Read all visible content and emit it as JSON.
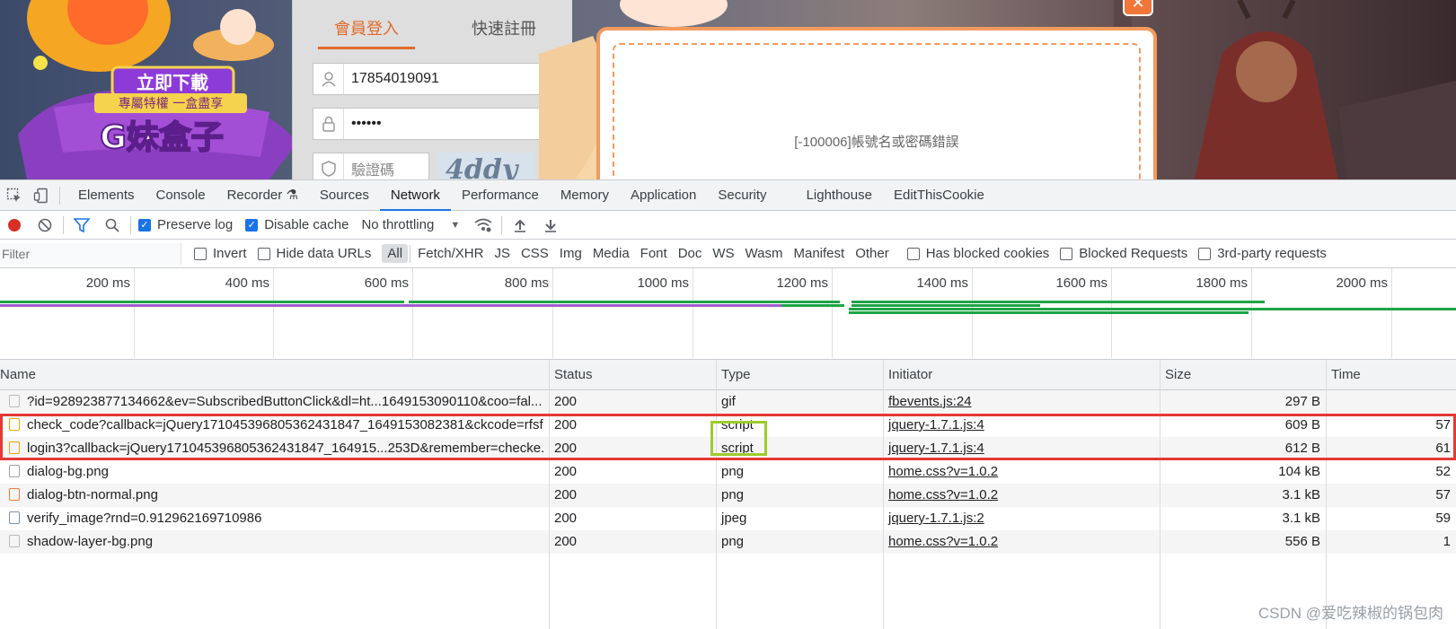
{
  "login": {
    "tab_login": "會員登入",
    "tab_register": "快速註冊",
    "username_value": "17854019091",
    "password_value": "••••••",
    "captcha_placeholder": "驗證碼",
    "captcha_text": "4ddy"
  },
  "banner": {
    "download_label": "立即下載",
    "sub_label": "專屬特權 一盒盡享",
    "brand_label": "G妹盒子"
  },
  "dialog": {
    "message": "[-100006]帳號名或密碼錯誤",
    "close_label": "✕"
  },
  "devtools": {
    "tabs": [
      "Elements",
      "Console",
      "Recorder ⚗",
      "Sources",
      "Network",
      "Performance",
      "Memory",
      "Application",
      "Security",
      "Lighthouse",
      "EditThisCookie"
    ],
    "active_tab": "Network",
    "toolbar": {
      "preserve_log": "Preserve log",
      "disable_cache": "Disable cache",
      "throttling": "No throttling"
    },
    "filter": {
      "placeholder": "Filter",
      "invert": "Invert",
      "hide_data_urls": "Hide data URLs",
      "types": [
        "All",
        "Fetch/XHR",
        "JS",
        "CSS",
        "Img",
        "Media",
        "Font",
        "Doc",
        "WS",
        "Wasm",
        "Manifest",
        "Other"
      ],
      "blocked_cookies": "Has blocked cookies",
      "blocked_requests": "Blocked Requests",
      "third_party": "3rd-party requests"
    },
    "timeline_ticks": [
      "200 ms",
      "400 ms",
      "600 ms",
      "800 ms",
      "1000 ms",
      "1200 ms",
      "1400 ms",
      "1600 ms",
      "1800 ms",
      "2000 ms"
    ],
    "columns": [
      "Name",
      "Status",
      "Type",
      "Initiator",
      "Size",
      "Time"
    ],
    "rows": [
      {
        "name": "?id=928923877134662&ev=SubscribedButtonClick&dl=ht...1649153090110&coo=fal...",
        "status": "200",
        "type": "gif",
        "initiator": "fbevents.js:24",
        "size": "297 B",
        "time": ""
      },
      {
        "name": "check_code?callback=jQuery17104539680536243184​7_1649153082381&ckcode=rfsf...",
        "status": "200",
        "type": "script",
        "initiator": "jquery-1.7.1.js:4",
        "size": "609 B",
        "time": "57"
      },
      {
        "name": "login3?callback=jQuery17104539680536243184​7_164915...253D&remember=checke...",
        "status": "200",
        "type": "script",
        "initiator": "jquery-1.7.1.js:4",
        "size": "612 B",
        "time": "61"
      },
      {
        "name": "dialog-bg.png",
        "status": "200",
        "type": "png",
        "initiator": "home.css?v=1.0.2",
        "size": "104 kB",
        "time": "52"
      },
      {
        "name": "dialog-btn-normal.png",
        "status": "200",
        "type": "png",
        "initiator": "home.css?v=1.0.2",
        "size": "3.1 kB",
        "time": "57"
      },
      {
        "name": "verify_image?rnd=0.912962169710986",
        "status": "200",
        "type": "jpeg",
        "initiator": "jquery-1.7.1.js:2",
        "size": "3.1 kB",
        "time": "59"
      },
      {
        "name": "shadow-layer-bg.png",
        "status": "200",
        "type": "png",
        "initiator": "home.css?v=1.0.2",
        "size": "556 B",
        "time": "1"
      }
    ]
  },
  "watermark": "CSDN @爱吃辣椒的锅包肉"
}
